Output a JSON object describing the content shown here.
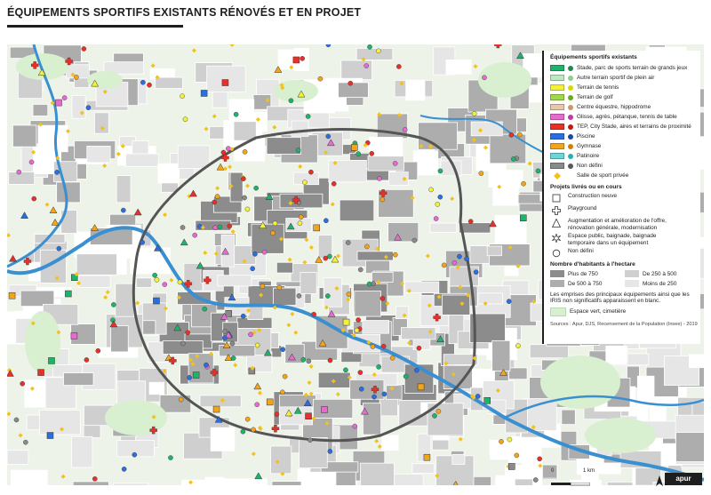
{
  "title": "ÉQUIPEMENTS SPORTIFS EXISTANTS RÉNOVÉS ET EN PROJET",
  "legend": {
    "section1_title": "Équipements sportifs existants",
    "equipment": [
      {
        "label": "Stade, parc de sports terrain de grands jeux",
        "color": "#1db36b",
        "dot": "#1a8a4f"
      },
      {
        "label": "Autre terrain sportif de plein air",
        "color": "#bfe8bf",
        "dot": "#8fce8f"
      },
      {
        "label": "Terrain de tennis",
        "color": "#f2f23a",
        "dot": "#d9d900"
      },
      {
        "label": "Terrain de golf",
        "color": "#9ed94a",
        "dot": "#6aaa1f"
      },
      {
        "label": "Centre équestre, hippodrome",
        "color": "#e8c8a8",
        "dot": "#c89a6a"
      },
      {
        "label": "Glisse, agrès, pétanque, tennis de table",
        "color": "#e86ad0",
        "dot": "#c23aa8"
      },
      {
        "label": "TEP, City Stade, aires et terrains de proximité",
        "color": "#e8302a",
        "dot": "#c01a14"
      },
      {
        "label": "Piscine",
        "color": "#2a6ee0",
        "dot": "#1a4aa8"
      },
      {
        "label": "Gymnase",
        "color": "#f2a41a",
        "dot": "#d08000"
      },
      {
        "label": "Patinoire",
        "color": "#6ad6d6",
        "dot": "#2ab0b0"
      },
      {
        "label": "Non défini",
        "color": "#8a8a8a",
        "dot": "#5a5a5a"
      }
    ],
    "private_gym": "Salle de sport privée",
    "section2_title": "Projets livrés ou en cours",
    "projects": [
      {
        "label": "Construction neuve",
        "symbol": "square"
      },
      {
        "label": "Playground",
        "symbol": "cross"
      },
      {
        "label": "Augmentation et amélioration de l'offre, rénovation générale, modernisation",
        "symbol": "triangle"
      },
      {
        "label": "Espace public, baignade, baignade temporaire dans un équipement",
        "symbol": "star"
      },
      {
        "label": "Non défini",
        "symbol": "circle"
      }
    ],
    "section3_title": "Nombre d'habitants à l'hectare",
    "density": [
      {
        "label": "Plus de 750",
        "color": "#8c8c8c"
      },
      {
        "label": "De 250 à 500",
        "color": "#cfcfcf"
      },
      {
        "label": "De 500 à 750",
        "color": "#adadad"
      },
      {
        "label": "Moins de 250",
        "color": "#e6e6e6"
      }
    ],
    "note": "Les emprises des principaux équipements ainsi que les IRIS non significatifs apparaissent en blanc.",
    "green_label": "Espace vert, cimetière",
    "green_color": "#d8efd0",
    "source": "Sources : Apur, DJS, Recensement de la Population (Insee) - 2019"
  },
  "scale": {
    "zero": "0",
    "one": "1 km"
  },
  "logo": "apur",
  "colors": {
    "water": "#3a8fd0",
    "boundary": "#555555"
  }
}
